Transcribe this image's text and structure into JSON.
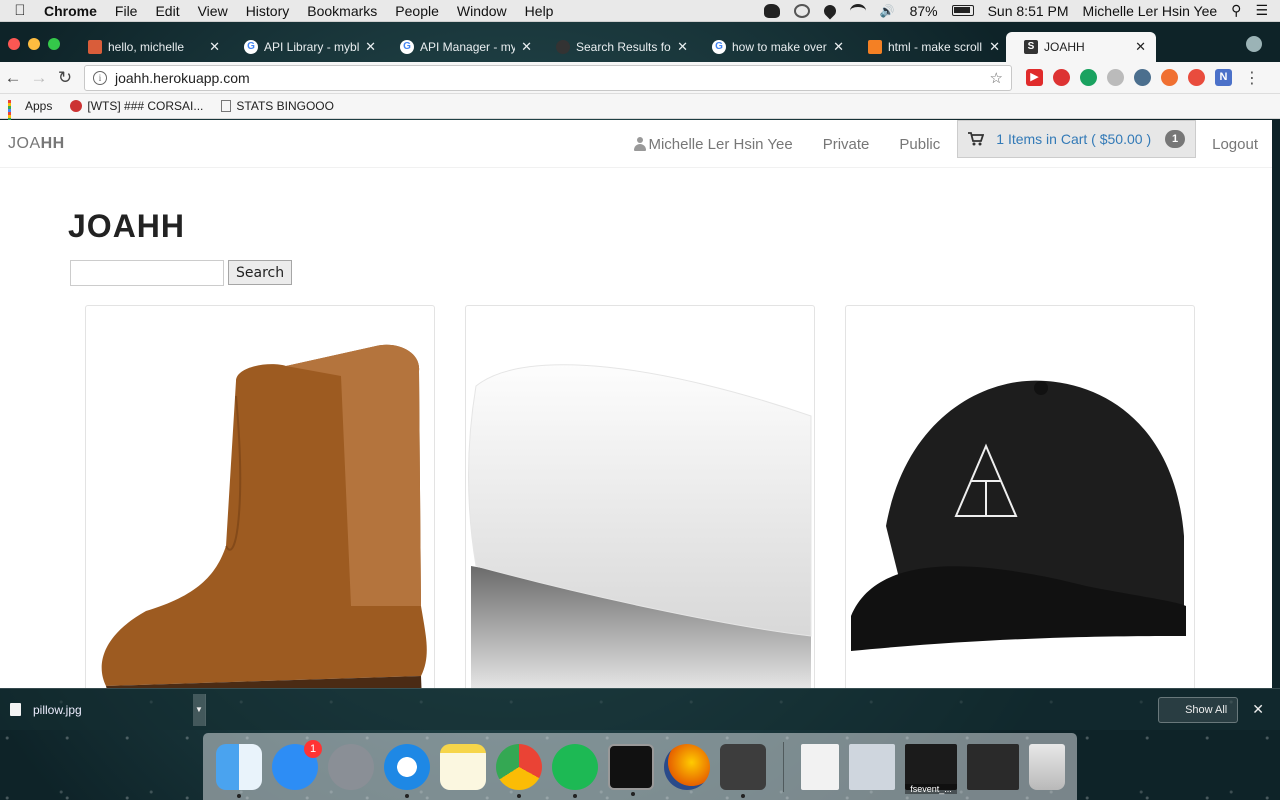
{
  "menubar": {
    "app_name": "Chrome",
    "menus": [
      "File",
      "Edit",
      "View",
      "History",
      "Bookmarks",
      "People",
      "Window",
      "Help"
    ],
    "battery": "87%",
    "clock": "Sun 8:51 PM",
    "user": "Michelle Ler Hsin Yee"
  },
  "tabs": [
    {
      "title": "hello, michelle",
      "icon": "bars-icon"
    },
    {
      "title": "API Library - mybl",
      "icon": "google-icon"
    },
    {
      "title": "API Manager - my",
      "icon": "google-icon"
    },
    {
      "title": "Search Results for",
      "icon": "search-results-icon"
    },
    {
      "title": "how to make over",
      "icon": "google-icon"
    },
    {
      "title": "html - make scroll",
      "icon": "stackoverflow-icon"
    },
    {
      "title": "JOAHH",
      "icon": "joahh-favicon",
      "active": true
    }
  ],
  "address": {
    "url": "joahh.herokuapp.com"
  },
  "bookmarks": [
    {
      "label": "Apps"
    },
    {
      "label": "[WTS] ### CORSAI..."
    },
    {
      "label": "STATS BINGOOO"
    }
  ],
  "site": {
    "brand_light": "JOA",
    "brand_bold": "HH",
    "nav": {
      "user": "Michelle Ler Hsin Yee",
      "private": "Private",
      "public": "Public",
      "cart_label": "1 Items in Cart ( $50.00 )",
      "cart_count": "1",
      "logout": "Logout"
    },
    "title_a": "JOA",
    "title_b": "HH",
    "search_button": "Search",
    "search_placeholder": "",
    "products": [
      {
        "name": "brown-leather-boot"
      },
      {
        "name": "white-pillow"
      },
      {
        "name": "black-baseball-cap"
      }
    ]
  },
  "download_shelf": {
    "file": "pillow.jpg",
    "show_all": "Show All"
  },
  "dock": {
    "appstore_badge": "1",
    "fsevent_label": "fsevent_..."
  },
  "colors": {
    "link": "#337ab7",
    "cart_bg": "#e7e7e7",
    "badge": "#777777"
  }
}
